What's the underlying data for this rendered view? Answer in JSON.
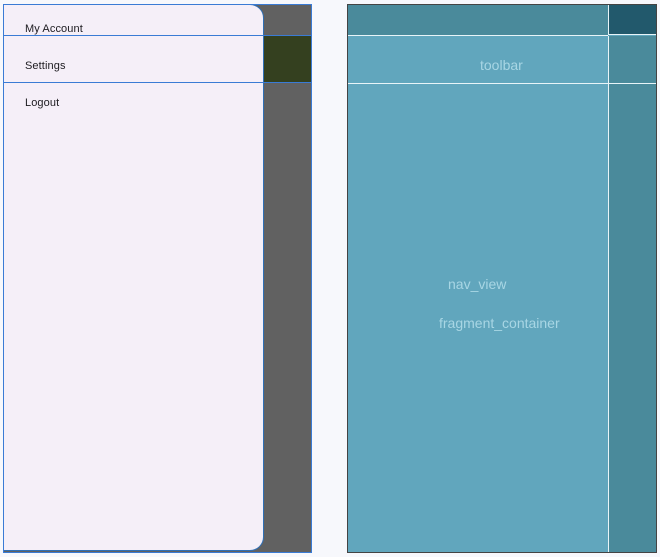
{
  "design_view": {
    "menu": {
      "items": [
        {
          "label": "My Account"
        },
        {
          "label": "Settings"
        },
        {
          "label": "Logout"
        }
      ]
    }
  },
  "blueprint_view": {
    "labels": {
      "toolbar": "toolbar",
      "nav_view": "nav_view",
      "fragment_container": "fragment_container"
    }
  },
  "colors": {
    "drawer_bg": "#f5eff8",
    "scrim": "#616161",
    "selection_outline": "#3a7bd5",
    "blueprint_bg": "#61a6bd",
    "blueprint_dark": "#4a8a9b",
    "blueprint_darker": "#22596c",
    "blueprint_label": "#a8d6e4"
  }
}
